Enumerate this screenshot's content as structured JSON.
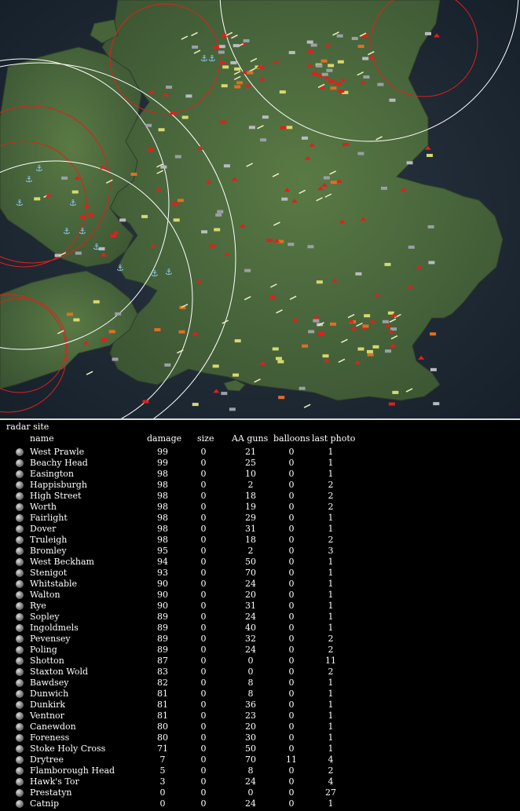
{
  "panel": {
    "title": "radar site",
    "headers": {
      "name": "name",
      "damage": "damage",
      "size": "size",
      "aa": "AA guns",
      "balloons": "balloons",
      "photo": "last photo"
    },
    "rows": [
      {
        "name": "West Prawle",
        "damage": "99",
        "size": "0",
        "aa": "21",
        "balloons": "0",
        "photo": "1"
      },
      {
        "name": "Beachy Head",
        "damage": "99",
        "size": "0",
        "aa": "25",
        "balloons": "0",
        "photo": "1"
      },
      {
        "name": "Easington",
        "damage": "98",
        "size": "0",
        "aa": "10",
        "balloons": "0",
        "photo": "1"
      },
      {
        "name": "Happisburgh",
        "damage": "98",
        "size": "0",
        "aa": "2",
        "balloons": "0",
        "photo": "2"
      },
      {
        "name": "High Street",
        "damage": "98",
        "size": "0",
        "aa": "18",
        "balloons": "0",
        "photo": "2"
      },
      {
        "name": "Worth",
        "damage": "98",
        "size": "0",
        "aa": "19",
        "balloons": "0",
        "photo": "2"
      },
      {
        "name": "Fairlight",
        "damage": "98",
        "size": "0",
        "aa": "29",
        "balloons": "0",
        "photo": "1"
      },
      {
        "name": "Dover",
        "damage": "98",
        "size": "0",
        "aa": "31",
        "balloons": "0",
        "photo": "1"
      },
      {
        "name": "Truleigh",
        "damage": "98",
        "size": "0",
        "aa": "18",
        "balloons": "0",
        "photo": "2"
      },
      {
        "name": "Bromley",
        "damage": "95",
        "size": "0",
        "aa": "2",
        "balloons": "0",
        "photo": "3"
      },
      {
        "name": "West Beckham",
        "damage": "94",
        "size": "0",
        "aa": "50",
        "balloons": "0",
        "photo": "1"
      },
      {
        "name": "Stenigot",
        "damage": "93",
        "size": "0",
        "aa": "70",
        "balloons": "0",
        "photo": "1"
      },
      {
        "name": "Whitstable",
        "damage": "90",
        "size": "0",
        "aa": "24",
        "balloons": "0",
        "photo": "1"
      },
      {
        "name": "Walton",
        "damage": "90",
        "size": "0",
        "aa": "20",
        "balloons": "0",
        "photo": "1"
      },
      {
        "name": "Rye",
        "damage": "90",
        "size": "0",
        "aa": "31",
        "balloons": "0",
        "photo": "1"
      },
      {
        "name": "Sopley",
        "damage": "89",
        "size": "0",
        "aa": "24",
        "balloons": "0",
        "photo": "1"
      },
      {
        "name": "Ingoldmels",
        "damage": "89",
        "size": "0",
        "aa": "40",
        "balloons": "0",
        "photo": "1"
      },
      {
        "name": "Pevensey",
        "damage": "89",
        "size": "0",
        "aa": "32",
        "balloons": "0",
        "photo": "2"
      },
      {
        "name": "Poling",
        "damage": "89",
        "size": "0",
        "aa": "24",
        "balloons": "0",
        "photo": "2"
      },
      {
        "name": "Shotton",
        "damage": "87",
        "size": "0",
        "aa": "0",
        "balloons": "0",
        "photo": "11"
      },
      {
        "name": "Staxton Wold",
        "damage": "83",
        "size": "0",
        "aa": "0",
        "balloons": "0",
        "photo": "2"
      },
      {
        "name": "Bawdsey",
        "damage": "82",
        "size": "0",
        "aa": "8",
        "balloons": "0",
        "photo": "1"
      },
      {
        "name": "Dunwich",
        "damage": "81",
        "size": "0",
        "aa": "8",
        "balloons": "0",
        "photo": "1"
      },
      {
        "name": "Dunkirk",
        "damage": "81",
        "size": "0",
        "aa": "36",
        "balloons": "0",
        "photo": "1"
      },
      {
        "name": "Ventnor",
        "damage": "81",
        "size": "0",
        "aa": "23",
        "balloons": "0",
        "photo": "1"
      },
      {
        "name": "Canewdon",
        "damage": "80",
        "size": "0",
        "aa": "20",
        "balloons": "0",
        "photo": "1"
      },
      {
        "name": "Foreness",
        "damage": "80",
        "size": "0",
        "aa": "30",
        "balloons": "0",
        "photo": "1"
      },
      {
        "name": "Stoke Holy Cross",
        "damage": "71",
        "size": "0",
        "aa": "50",
        "balloons": "0",
        "photo": "1"
      },
      {
        "name": "Drytree",
        "damage": "7",
        "size": "0",
        "aa": "70",
        "balloons": "11",
        "photo": "4"
      },
      {
        "name": "Flamborough Head",
        "damage": "5",
        "size": "0",
        "aa": "8",
        "balloons": "0",
        "photo": "2"
      },
      {
        "name": "Hawk's Tor",
        "damage": "3",
        "size": "0",
        "aa": "24",
        "balloons": "0",
        "photo": "4"
      },
      {
        "name": "Prestatyn",
        "damage": "0",
        "size": "0",
        "aa": "0",
        "balloons": "0",
        "photo": "27"
      },
      {
        "name": "Catnip",
        "damage": "0",
        "size": "0",
        "aa": "24",
        "balloons": "0",
        "photo": "1"
      }
    ]
  },
  "map": {
    "sea_color": "#1d2a36",
    "land_color": "#4d6b3a",
    "red_circle_color": "#e0201c",
    "white_circle_color": "#ffffff",
    "marker_icons": [
      "factory-icon",
      "anchor-icon",
      "airfield-icon",
      "radar-icon"
    ]
  }
}
